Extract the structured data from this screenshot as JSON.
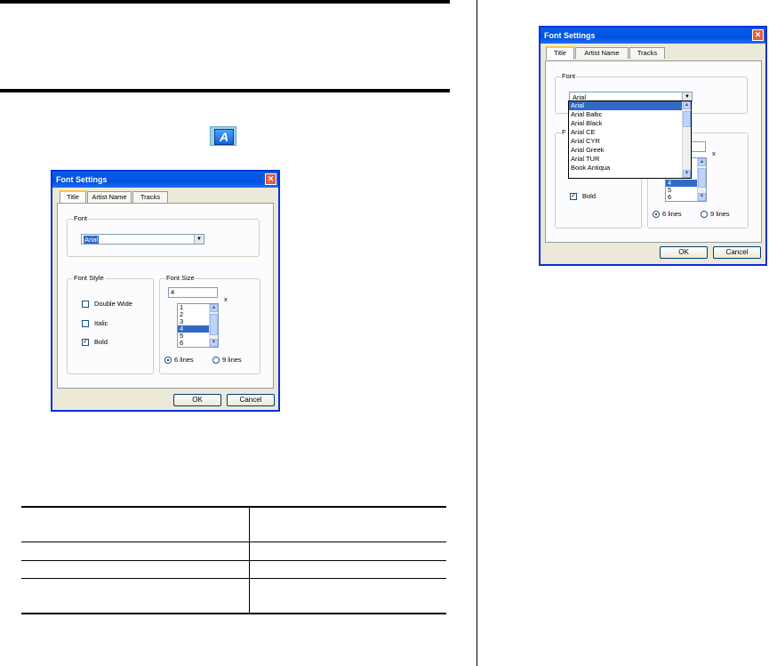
{
  "dialog_left": {
    "title": "Font Settings",
    "close_glyph": "✕",
    "tabs": [
      "Title",
      "Artist Name",
      "Tracks"
    ],
    "font_group_label": "Font",
    "font_value": "Arial",
    "font_style_label": "Font Style",
    "checkboxes": [
      {
        "label": "Double Wide",
        "checked": false
      },
      {
        "label": "Italic",
        "checked": false
      },
      {
        "label": "Bold",
        "checked": true
      }
    ],
    "font_size_label": "Font Size",
    "font_size_value": "4",
    "font_size_suffix": "x",
    "size_list": [
      "1",
      "2",
      "3",
      "4",
      "5",
      "6"
    ],
    "size_list_selected": "4",
    "radios": [
      {
        "label": "6 lines",
        "checked": true
      },
      {
        "label": "9 lines",
        "checked": false
      }
    ],
    "ok_label": "OK",
    "cancel_label": "Cancel"
  },
  "dialog_right": {
    "title": "Font Settings",
    "close_glyph": "✕",
    "tabs": [
      "Title",
      "Artist Name",
      "Tracks"
    ],
    "font_group_label": "Font",
    "font_value": "Arial",
    "font_list": [
      "Arial",
      "Arial Baltic",
      "Arial Black",
      "Arial CE",
      "Arial CYR",
      "Arial Greek",
      "Arial TUR",
      "Book Antiqua"
    ],
    "font_list_selected": "Arial",
    "font_style_label_partial": "F",
    "checkbox_bold_label": "Bold",
    "font_size_suffix": "x",
    "size_list_visible": [
      "4",
      "5",
      "6"
    ],
    "size_list_selected": "4",
    "radios": [
      {
        "label": "6 lines",
        "checked": true
      },
      {
        "label": "9 lines",
        "checked": false
      }
    ],
    "ok_label": "OK",
    "cancel_label": "Cancel"
  },
  "toolbar_icon": {
    "glyph": "A"
  },
  "checkmark_glyph": "✓"
}
